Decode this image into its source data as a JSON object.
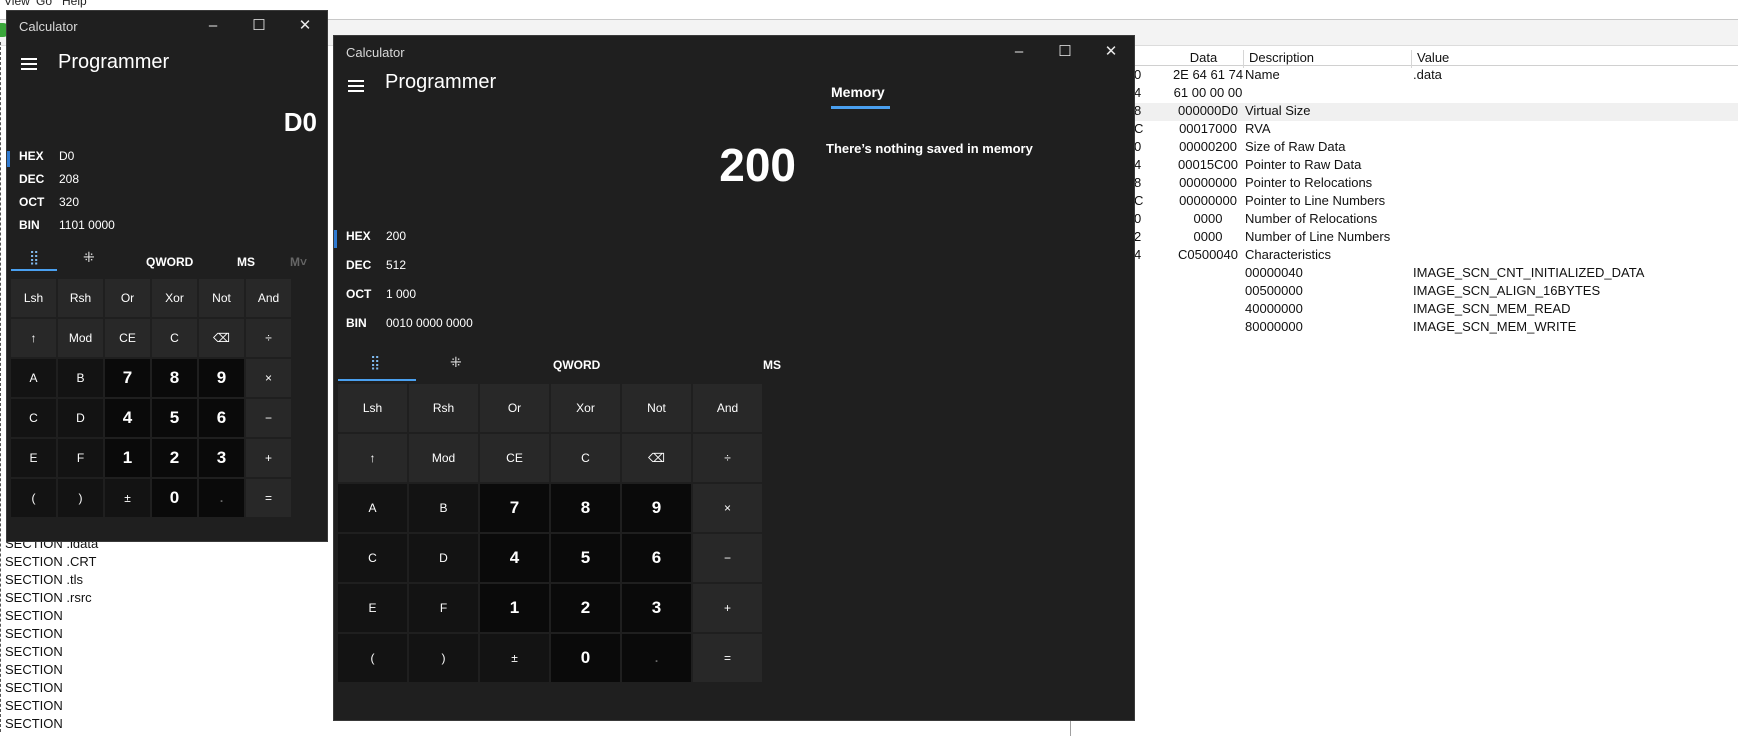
{
  "background_app": {
    "menu": [
      "View",
      "Go",
      "Help"
    ],
    "columns": [
      "Data",
      "Description",
      "Value"
    ],
    "rows": [
      {
        "off": "0",
        "data": "2E  64  61  74",
        "desc": "Name",
        "val": ".data",
        "sel": false
      },
      {
        "off": "4",
        "data": "61  00  00  00",
        "desc": "",
        "val": "",
        "sel": false
      },
      {
        "off": "8",
        "data": "000000D0",
        "desc": "Virtual Size",
        "val": "",
        "sel": true
      },
      {
        "off": "C",
        "data": "00017000",
        "desc": "RVA",
        "val": "",
        "sel": false
      },
      {
        "off": "0",
        "data": "00000200",
        "desc": "Size of Raw Data",
        "val": "",
        "sel": false
      },
      {
        "off": "4",
        "data": "00015C00",
        "desc": "Pointer to Raw Data",
        "val": "",
        "sel": false
      },
      {
        "off": "8",
        "data": "00000000",
        "desc": "Pointer to Relocations",
        "val": "",
        "sel": false
      },
      {
        "off": "C",
        "data": "00000000",
        "desc": "Pointer to Line Numbers",
        "val": "",
        "sel": false
      },
      {
        "off": "0",
        "data": "0000",
        "desc": "Number of Relocations",
        "val": "",
        "sel": false
      },
      {
        "off": "2",
        "data": "0000",
        "desc": "Number of Line Numbers",
        "val": "",
        "sel": false
      },
      {
        "off": "4",
        "data": "C0500040",
        "desc": "Characteristics",
        "val": "",
        "sel": false
      },
      {
        "off": "",
        "data": "",
        "desc": "00000040",
        "val": "IMAGE_SCN_CNT_INITIALIZED_DATA",
        "sel": false
      },
      {
        "off": "",
        "data": "",
        "desc": "00500000",
        "val": "IMAGE_SCN_ALIGN_16BYTES",
        "sel": false
      },
      {
        "off": "",
        "data": "",
        "desc": "40000000",
        "val": "IMAGE_SCN_MEM_READ",
        "sel": false
      },
      {
        "off": "",
        "data": "",
        "desc": "80000000",
        "val": "IMAGE_SCN_MEM_WRITE",
        "sel": false
      }
    ],
    "sections": [
      "SECTION .idata",
      "SECTION .CRT",
      "SECTION .tls",
      "SECTION .rsrc",
      "SECTION",
      "SECTION",
      "SECTION",
      "SECTION",
      "SECTION",
      "SECTION",
      "SECTION"
    ]
  },
  "calc_small": {
    "title": "Calculator",
    "mode": "Programmer",
    "display": "D0",
    "radix": [
      {
        "key": "HEX",
        "value": "D0"
      },
      {
        "key": "DEC",
        "value": "208"
      },
      {
        "key": "OCT",
        "value": "320"
      },
      {
        "key": "BIN",
        "value": "1101 0000"
      }
    ],
    "word_size": "QWORD",
    "ms": "MS",
    "mr": "M˅"
  },
  "calc_large": {
    "title": "Calculator",
    "mode": "Programmer",
    "display": "200",
    "radix": [
      {
        "key": "HEX",
        "value": "200"
      },
      {
        "key": "DEC",
        "value": "512"
      },
      {
        "key": "OCT",
        "value": "1 000"
      },
      {
        "key": "BIN",
        "value": "0010 0000 0000"
      }
    ],
    "word_size": "QWORD",
    "ms": "MS",
    "memory_tab": "Memory",
    "memory_empty": "There’s nothing saved in memory"
  },
  "keys": [
    [
      "Lsh",
      "Rsh",
      "Or",
      "Xor",
      "Not",
      "And"
    ],
    [
      "↑",
      "Mod",
      "CE",
      "C",
      "⌫",
      "÷"
    ],
    [
      "A",
      "B",
      "7",
      "8",
      "9",
      "×"
    ],
    [
      "C",
      "D",
      "4",
      "5",
      "6",
      "−"
    ],
    [
      "E",
      "F",
      "1",
      "2",
      "3",
      "+"
    ],
    [
      "(",
      ")",
      "±",
      "0",
      ".",
      "="
    ]
  ],
  "icons": {
    "minimize": "minimize-icon",
    "maximize": "maximize-icon",
    "close": "close-icon",
    "menu": "hamburger-icon",
    "keypad": "keypad-icon",
    "bitflip": "bit-toggle-icon"
  }
}
